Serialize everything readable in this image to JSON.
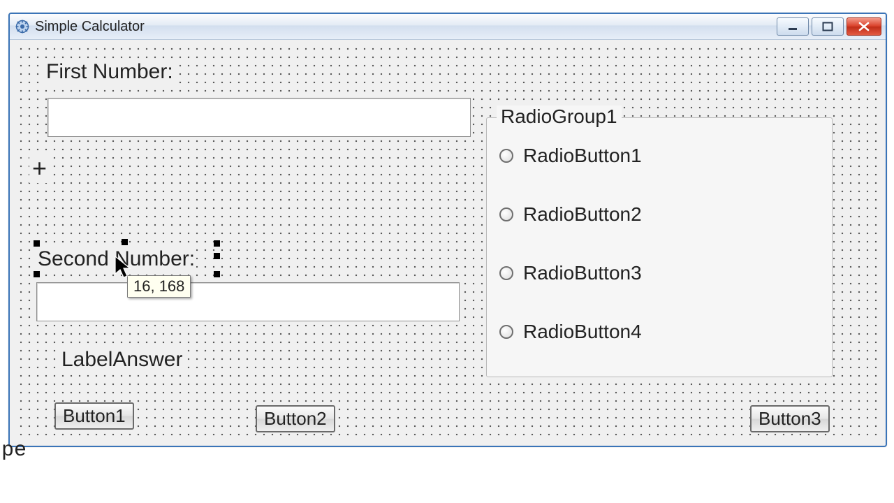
{
  "window": {
    "title": "Simple Calculator"
  },
  "labels": {
    "first": "First Number:",
    "plus": "+",
    "second": "Second Number:",
    "answer": "LabelAnswer"
  },
  "radiogroup": {
    "caption": "RadioGroup1",
    "items": [
      "RadioButton1",
      "RadioButton2",
      "RadioButton3",
      "RadioButton4"
    ]
  },
  "buttons": {
    "b1": "Button1",
    "b2": "Button2",
    "b3": "Button3"
  },
  "tooltip": "16, 168",
  "stray": "pe"
}
